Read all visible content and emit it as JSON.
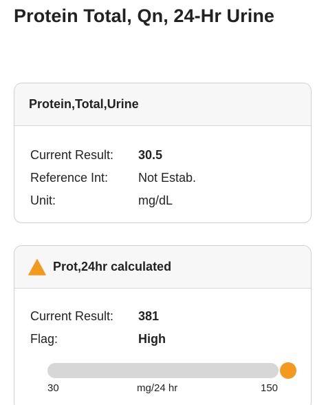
{
  "page": {
    "title": "Protein Total, Qn, 24-Hr Urine"
  },
  "cards": [
    {
      "header": "Protein,Total,Urine",
      "rows": [
        {
          "label": "Current Result:",
          "value": "30.5"
        },
        {
          "label": "Reference Int:",
          "value": "Not Estab."
        },
        {
          "label": "Unit:",
          "value": "mg/dL"
        }
      ]
    },
    {
      "header": "Prot,24hr calculated",
      "header_icon": "warning-triangle-icon",
      "rows": [
        {
          "label": "Current Result:",
          "value": "381"
        },
        {
          "label": "Flag:",
          "value": "High"
        }
      ],
      "range": {
        "min": "30",
        "unit": "mg/24 hr",
        "max": "150",
        "result_value": 381,
        "marker_color": "#f39a1e"
      }
    }
  ],
  "colors": {
    "warning": "#f39a1e",
    "track": "#d7d7d7"
  }
}
